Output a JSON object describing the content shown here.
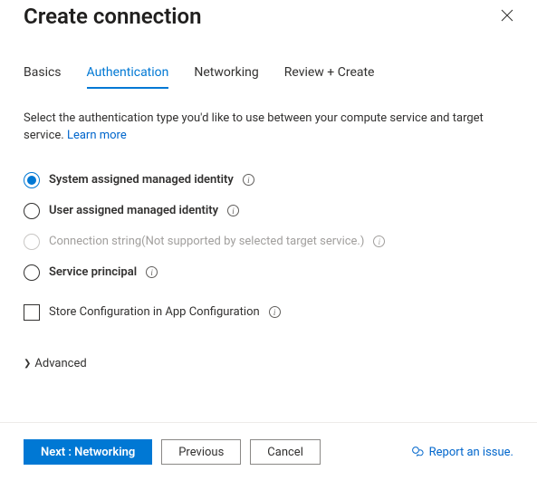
{
  "header": {
    "title": "Create connection"
  },
  "tabs": [
    {
      "id": "basics",
      "label": "Basics",
      "active": false
    },
    {
      "id": "auth",
      "label": "Authentication",
      "active": true
    },
    {
      "id": "network",
      "label": "Networking",
      "active": false
    },
    {
      "id": "review",
      "label": "Review + Create",
      "active": false
    }
  ],
  "description": {
    "text": "Select the authentication type you'd like to use between your compute service and target service.",
    "learn_more": "Learn more"
  },
  "auth_options": [
    {
      "id": "sami",
      "label": "System assigned managed identity",
      "checked": true,
      "disabled": false,
      "note": ""
    },
    {
      "id": "uami",
      "label": "User assigned managed identity",
      "checked": false,
      "disabled": false,
      "note": ""
    },
    {
      "id": "cs",
      "label": "Connection string",
      "checked": false,
      "disabled": true,
      "note": "(Not supported by selected target service.)"
    },
    {
      "id": "sp",
      "label": "Service principal",
      "checked": false,
      "disabled": false,
      "note": ""
    }
  ],
  "store_config": {
    "label": "Store Configuration in App Configuration",
    "checked": false
  },
  "advanced": {
    "label": "Advanced"
  },
  "footer": {
    "next": "Next : Networking",
    "previous": "Previous",
    "cancel": "Cancel",
    "report": "Report an issue."
  },
  "colors": {
    "accent": "#0078d4",
    "link": "#0066cc"
  }
}
